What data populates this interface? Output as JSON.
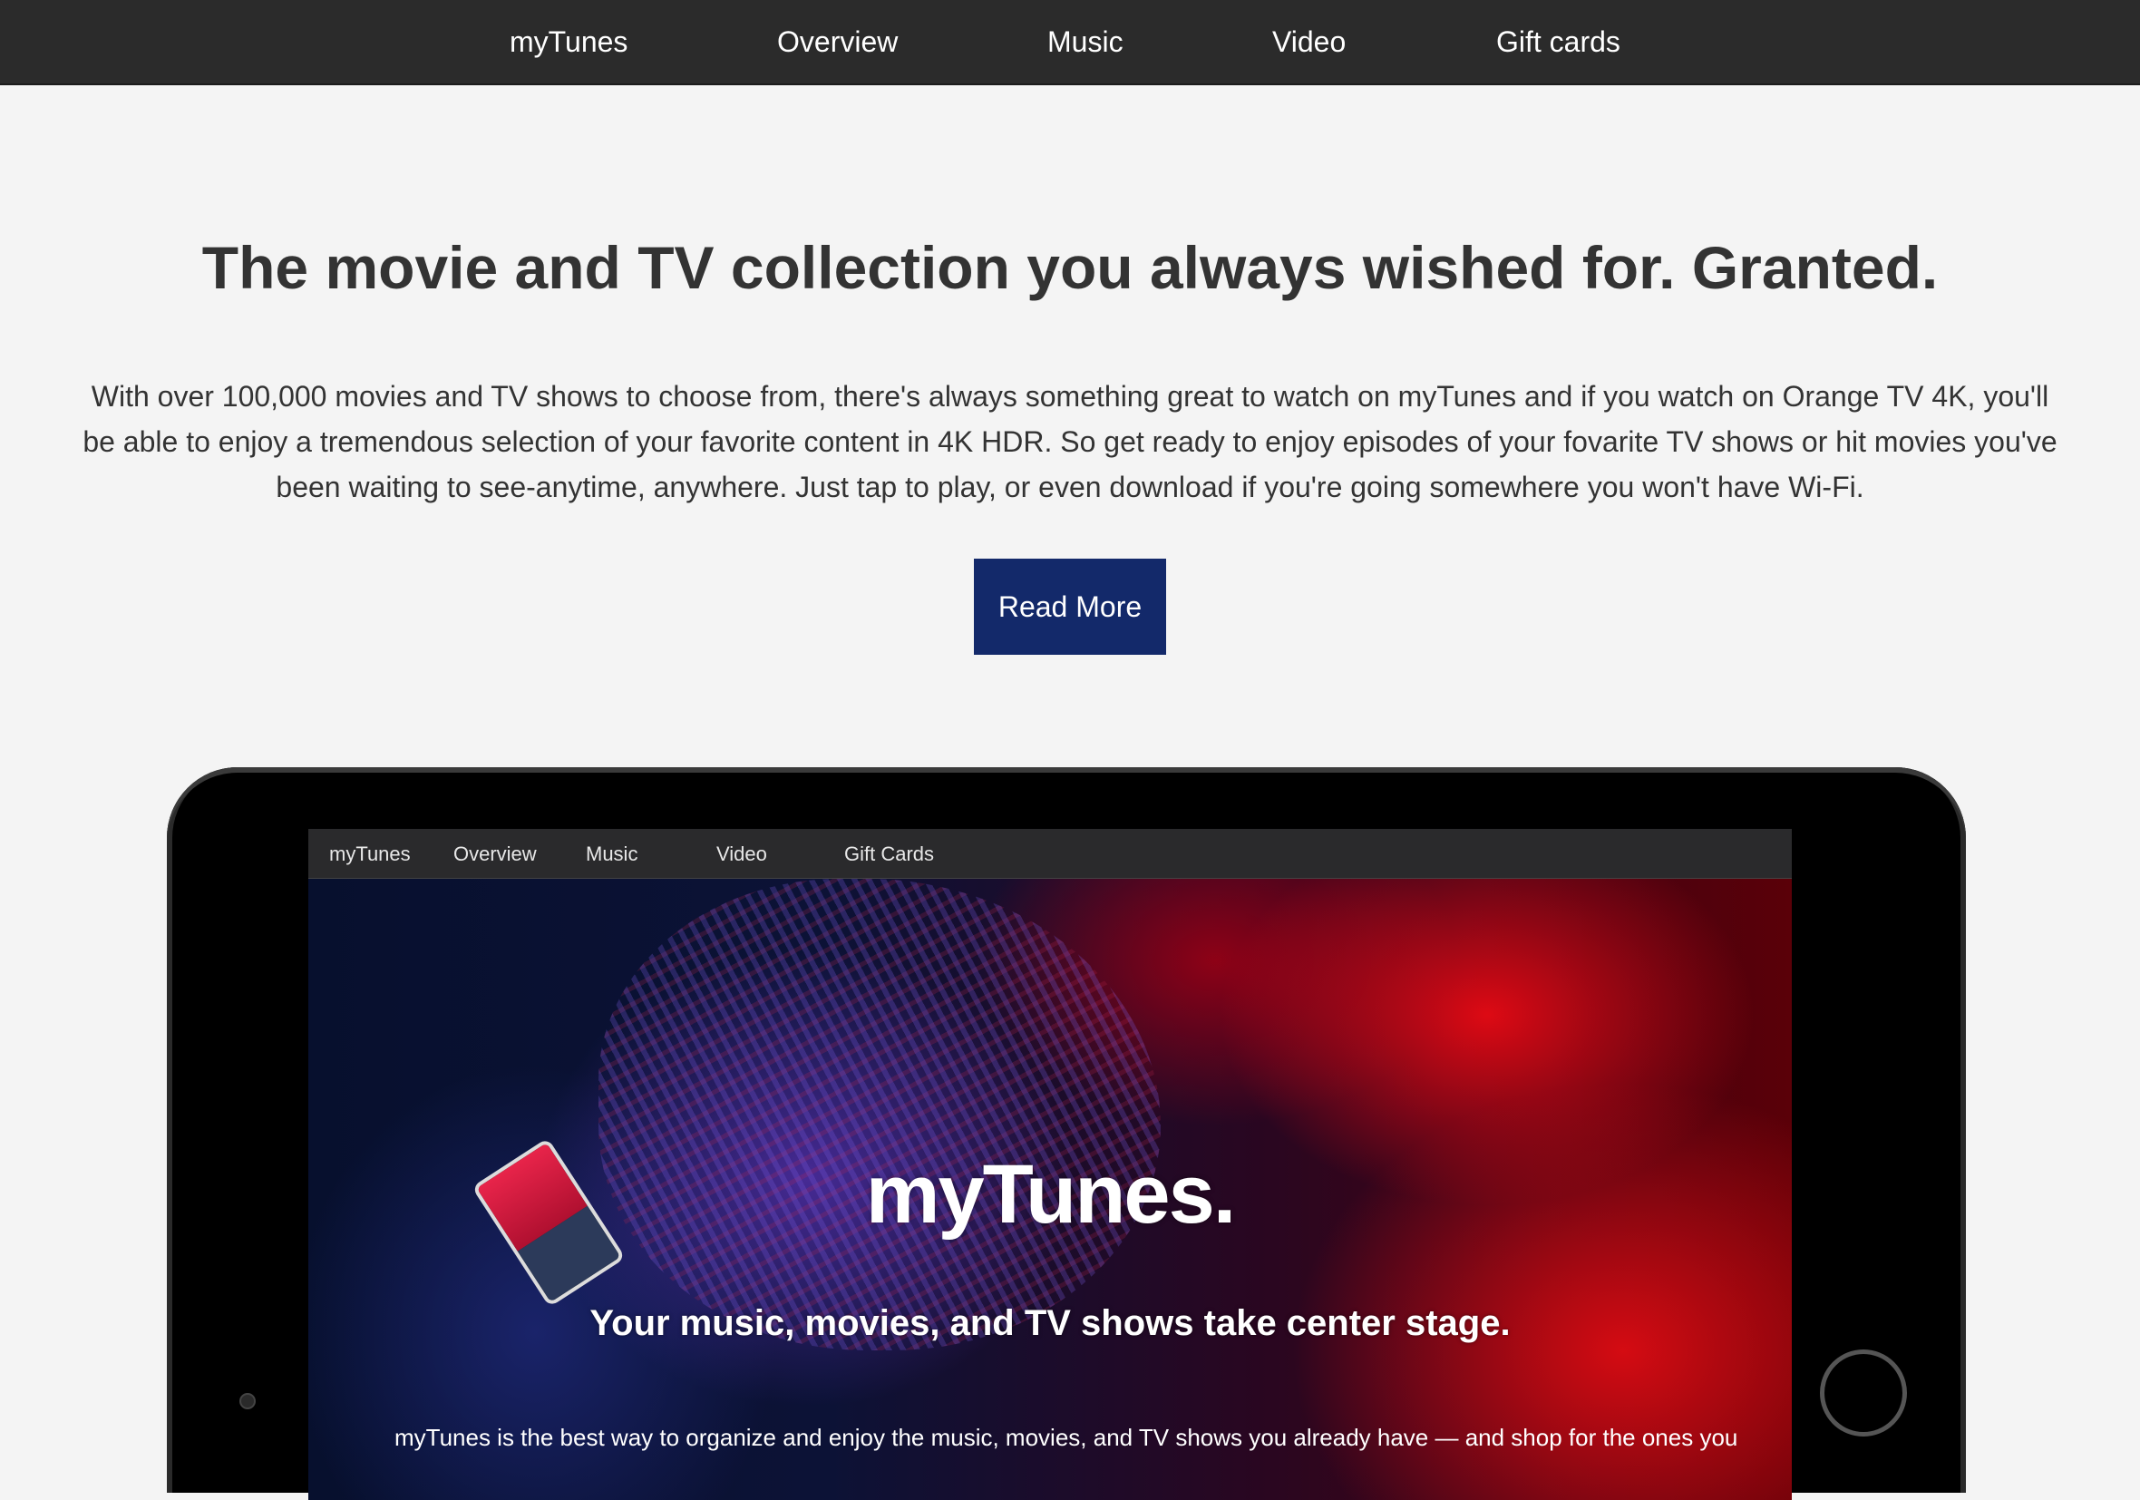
{
  "nav": {
    "items": [
      {
        "label": "myTunes"
      },
      {
        "label": "Overview"
      },
      {
        "label": "Music"
      },
      {
        "label": "Video"
      },
      {
        "label": "Gift cards"
      }
    ]
  },
  "main": {
    "headline": "The movie and TV collection you always wished for. Granted.",
    "intro": "With over 100,000 movies and TV shows to choose from, there's always something great to watch on myTunes and if you watch on Orange TV 4K, you'll be able to enjoy a tremendous selection of your favorite content in 4K HDR. So get ready to enjoy episodes of your fovarite TV shows or hit movies you've been waiting to see-anytime, anywhere. Just tap to play, or even download if you're going somewhere you won't have Wi-Fi.",
    "read_more_label": "Read More"
  },
  "tablet_screen": {
    "nav_items": [
      {
        "label": "myTunes"
      },
      {
        "label": "Overview"
      },
      {
        "label": "Music"
      },
      {
        "label": "Video"
      },
      {
        "label": "Gift Cards"
      }
    ],
    "logo": "myTunes.",
    "tagline": "Your music, movies, and TV shows take center stage.",
    "body": "myTunes is the best way to organize and enjoy the music, movies, and TV shows you already have — and shop for the ones you"
  },
  "colors": {
    "nav_background": "#2b2b2b",
    "page_background": "#f4f4f4",
    "button_background": "#13296a",
    "text": "#333333"
  }
}
